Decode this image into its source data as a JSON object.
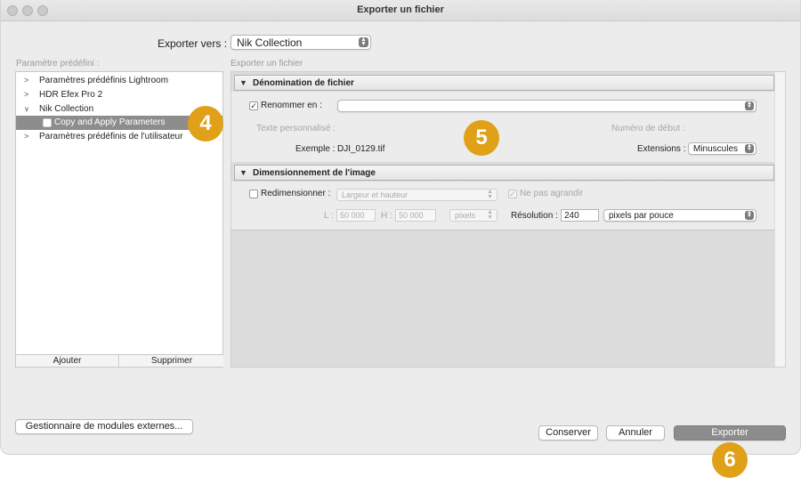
{
  "window": {
    "title": "Exporter un fichier"
  },
  "export_to": {
    "label": "Exporter vers :",
    "value": "Nik Collection"
  },
  "presets": {
    "caption": "Paramètre prédéfini :",
    "items": [
      {
        "label": "Paramètres prédéfinis Lightroom",
        "expanded": false
      },
      {
        "label": "HDR Efex Pro 2",
        "expanded": false
      },
      {
        "label": "Nik Collection",
        "expanded": true
      },
      {
        "label": "Copy and Apply Parameters",
        "selected": true
      },
      {
        "label": "Paramètres prédéfinis de l'utilisateur",
        "expanded": false
      }
    ],
    "add_label": "Ajouter",
    "remove_label": "Supprimer"
  },
  "settings": {
    "caption": "Exporter un fichier",
    "file_naming": {
      "header": "Dénomination de fichier",
      "rename_label": "Renommer en :",
      "rename_checked": true,
      "rename_value": "",
      "custom_text_label": "Texte personnalisé :",
      "start_number_label": "Numéro de début :",
      "example_label": "Exemple :",
      "example_value": "DJI_0129.tif",
      "extensions_label": "Extensions :",
      "extensions_value": "Minuscules"
    },
    "image_sizing": {
      "header": "Dimensionnement de l'image",
      "resize_label": "Redimensionner :",
      "resize_checked": false,
      "resize_mode": "Largeur et hauteur",
      "no_enlarge_label": "Ne pas agrandir",
      "no_enlarge_checked": true,
      "width_label": "L :",
      "width_value": "50 000",
      "height_label": "H :",
      "height_value": "50 000",
      "units": "pixels",
      "resolution_label": "Résolution :",
      "resolution_value": "240",
      "resolution_units": "pixels par pouce"
    }
  },
  "footer": {
    "plugin_manager_label": "Gestionnaire de modules externes...",
    "save_label": "Conserver",
    "cancel_label": "Annuler",
    "export_label": "Exporter"
  },
  "badges": [
    "4",
    "5",
    "6"
  ],
  "colors": {
    "badge": "#e0a017",
    "selection": "#8d8d8d",
    "primary_button": "#8c8c8c"
  }
}
